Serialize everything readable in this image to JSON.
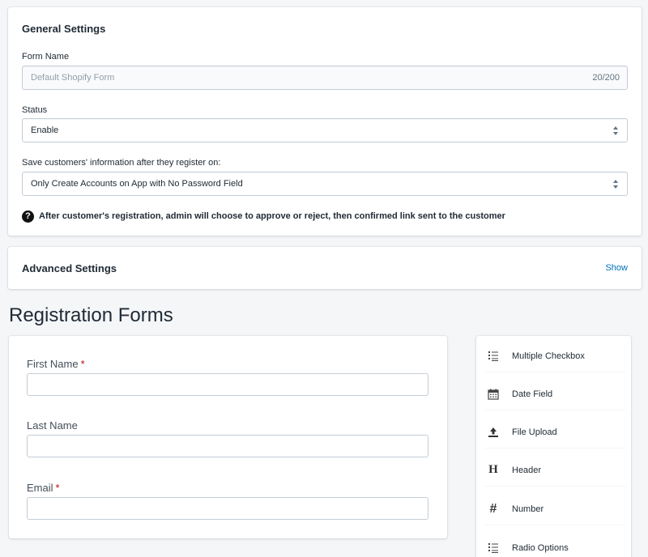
{
  "general_settings": {
    "title": "General Settings",
    "form_name": {
      "label": "Form Name",
      "value": "Default Shopify Form",
      "counter": "20/200"
    },
    "status": {
      "label": "Status",
      "value": "Enable"
    },
    "save_info": {
      "label": "Save customers' information after they register on:",
      "value": "Only Create Accounts on App with No Password Field"
    },
    "info_note": "After customer's registration, admin will choose to approve or reject, then confirmed link sent to the customer"
  },
  "advanced_settings": {
    "title": "Advanced Settings",
    "show_label": "Show"
  },
  "registration_forms": {
    "heading": "Registration Forms",
    "fields": [
      {
        "label": "First Name",
        "required": "*"
      },
      {
        "label": "Last Name",
        "required": ""
      },
      {
        "label": "Email",
        "required": "*"
      }
    ]
  },
  "palette": {
    "items": [
      {
        "label": "Multiple Checkbox",
        "icon": "list-icon"
      },
      {
        "label": "Date Field",
        "icon": "calendar-icon"
      },
      {
        "label": "File Upload",
        "icon": "upload-icon"
      },
      {
        "label": "Header",
        "icon": "header-icon"
      },
      {
        "label": "Number",
        "icon": "hash-icon"
      },
      {
        "label": "Radio Options",
        "icon": "list-icon"
      }
    ]
  },
  "colors": {
    "link": "#006fbb",
    "required": "#bf0711",
    "background": "#f4f6f8"
  }
}
